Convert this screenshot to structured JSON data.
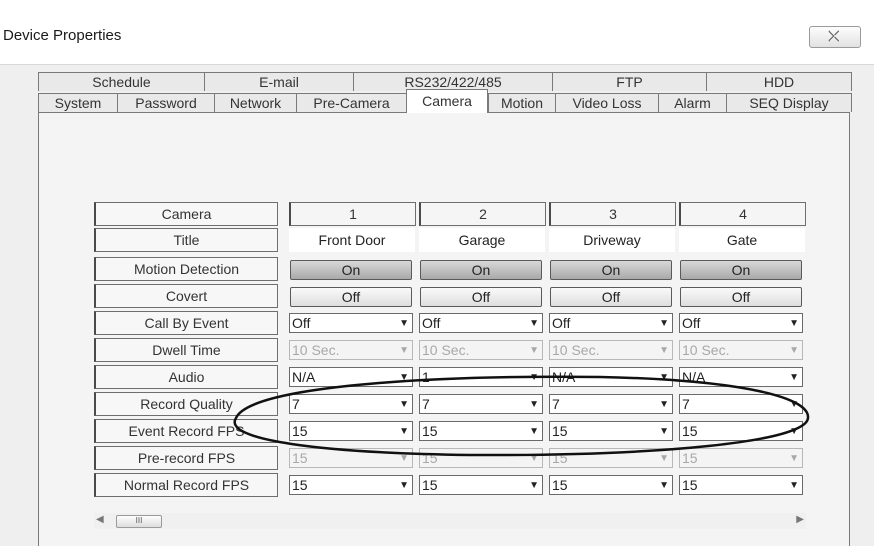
{
  "window": {
    "title": "Device Properties"
  },
  "tabs": {
    "row1": [
      "Schedule",
      "E-mail",
      "RS232/422/485",
      "FTP",
      "HDD"
    ],
    "row2": [
      "System",
      "Password",
      "Network",
      "Pre-Camera",
      "Camera",
      "Motion",
      "Video Loss",
      "Alarm",
      "SEQ Display"
    ],
    "active": "Camera"
  },
  "grid": {
    "row_labels": [
      "Camera",
      "Title",
      "Motion Detection",
      "Covert",
      "Call By Event",
      "Dwell Time",
      "Audio",
      "Record Quality",
      "Event Record FPS",
      "Pre-record FPS",
      "Normal Record FPS"
    ],
    "cameras": [
      {
        "number": "1",
        "title": "Front Door",
        "motion": "On",
        "covert": "Off",
        "call_by_event": "Off",
        "dwell": "10 Sec.",
        "audio": "N/A",
        "quality": "7",
        "event_fps": "15",
        "prerecord_fps": "15",
        "normal_fps": "15"
      },
      {
        "number": "2",
        "title": "Garage",
        "motion": "On",
        "covert": "Off",
        "call_by_event": "Off",
        "dwell": "10 Sec.",
        "audio": "1",
        "quality": "7",
        "event_fps": "15",
        "prerecord_fps": "15",
        "normal_fps": "15"
      },
      {
        "number": "3",
        "title": "Driveway",
        "motion": "On",
        "covert": "Off",
        "call_by_event": "Off",
        "dwell": "10 Sec.",
        "audio": "N/A",
        "quality": "7",
        "event_fps": "15",
        "prerecord_fps": "15",
        "normal_fps": "15"
      },
      {
        "number": "4",
        "title": "Gate",
        "motion": "On",
        "covert": "Off",
        "call_by_event": "Off",
        "dwell": "10 Sec.",
        "audio": "N/A",
        "quality": "7",
        "event_fps": "15",
        "prerecord_fps": "15",
        "normal_fps": "15"
      }
    ]
  },
  "scrollbar": {
    "thumb_glyph": "III"
  },
  "colors": {
    "button_on": "#b8b8b8",
    "button_off": "#ececec",
    "annotation": "#111111"
  }
}
